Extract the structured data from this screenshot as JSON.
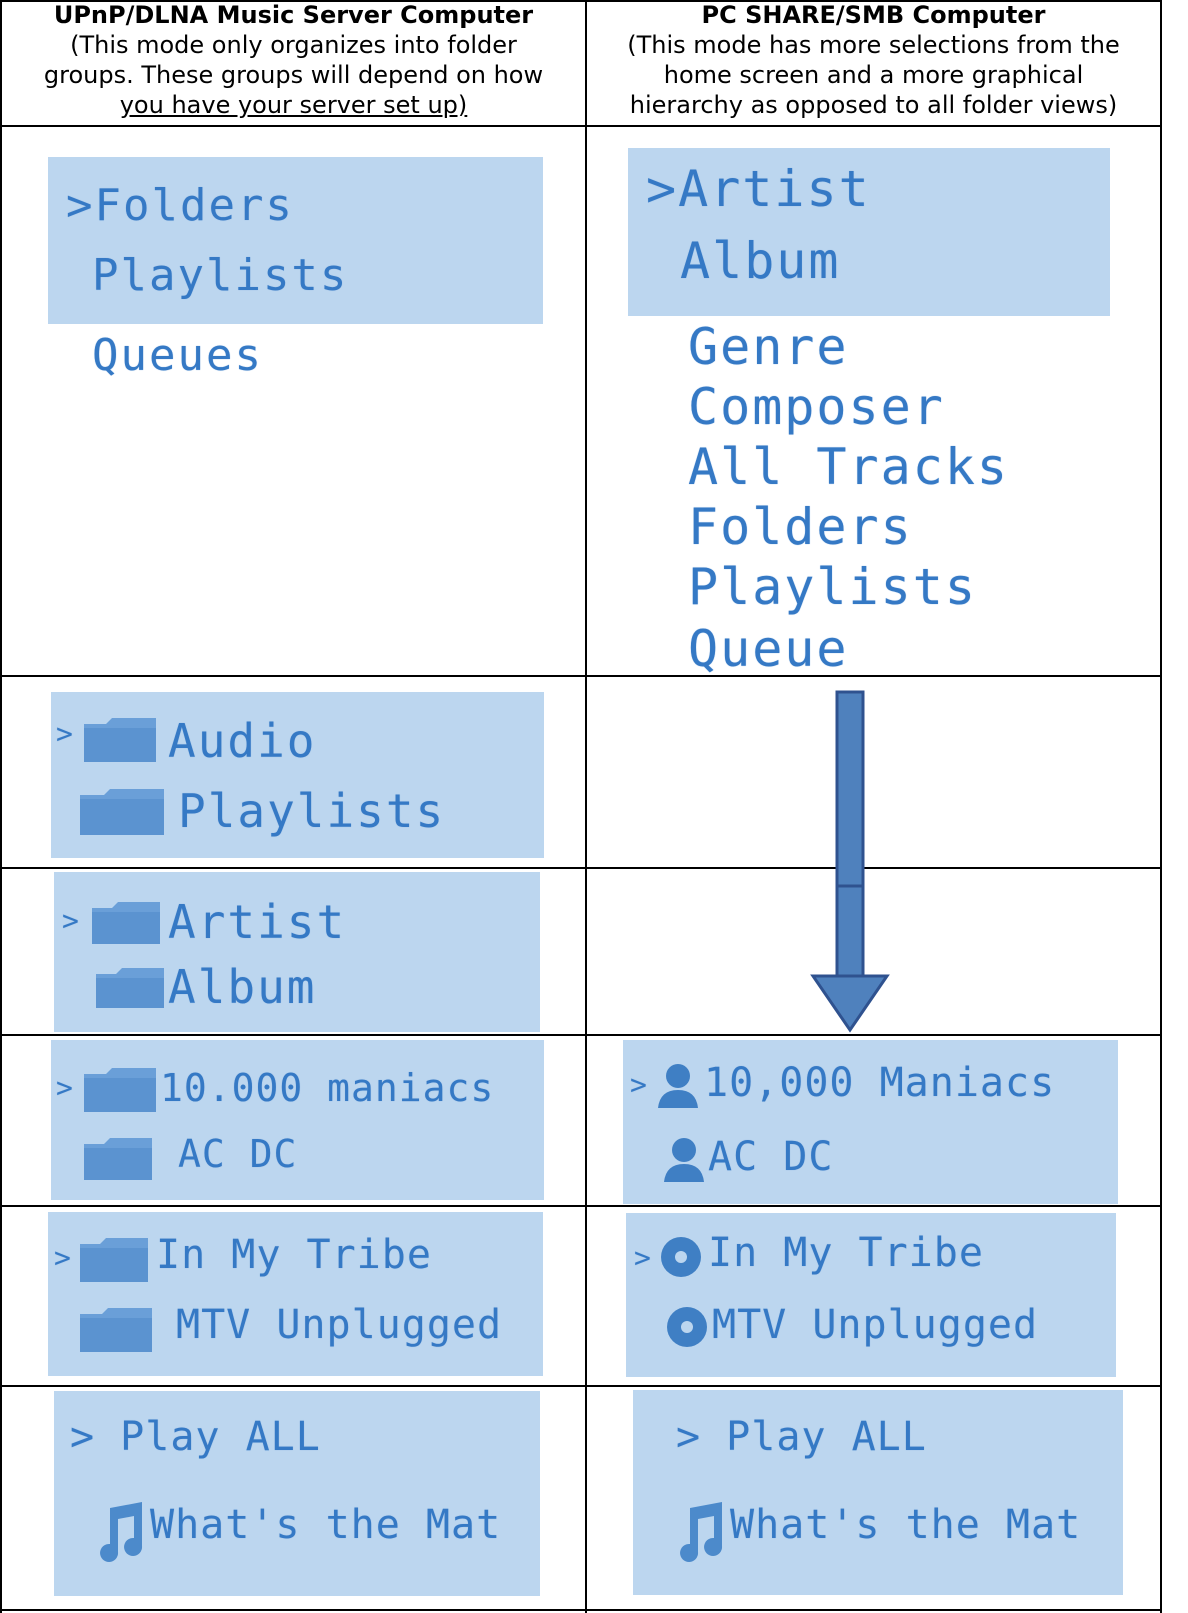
{
  "columns": [
    {
      "title": "UPnP/DLNA Music Server Computer",
      "desc": [
        "(This mode only organizes into folder",
        "groups.  These groups will depend on how",
        "you have your server set up)"
      ]
    },
    {
      "title": "PC SHARE/SMB Computer",
      "desc": [
        "(This mode has more selections from the",
        "home screen and a more graphical",
        "hierarchy as opposed to all folder views)"
      ]
    }
  ],
  "left": {
    "home": {
      "selected": ">Folders",
      "second": "Playlists",
      "below": "Queues"
    },
    "audio": {
      "cursor": ">",
      "item1": "Audio",
      "item2": "Playlists"
    },
    "artist": {
      "cursor": ">",
      "item1": "Artist",
      "item2": "Album"
    },
    "artists_list": {
      "cursor": ">",
      "item1": "10.000 maniacs",
      "item2": "AC DC"
    },
    "albums_list": {
      "cursor": ">",
      "item1": "In My Tribe",
      "item2": "MTV Unplugged"
    },
    "tracks_list": {
      "item1": "> Play ALL",
      "item2": "What's the Mat"
    }
  },
  "right": {
    "home": {
      "selected": ">Artist",
      "second": "Album",
      "below": [
        "Genre",
        "Composer",
        "All Tracks",
        "Folders",
        "Playlists",
        "Queue"
      ]
    },
    "artists_list": {
      "cursor": ">",
      "item1": "10,000 Maniacs",
      "item2": "AC DC"
    },
    "albums_list": {
      "cursor": ">",
      "item1": "In My Tribe",
      "item2": "MTV Unplugged"
    },
    "tracks_list": {
      "item1": "> Play ALL",
      "item2": "What's the Mat"
    }
  },
  "colors": {
    "panel": "#bcd6ef",
    "lcd_text": "#3579c5",
    "arrow_fill": "#4f81bd",
    "arrow_stroke": "#2f528f"
  },
  "icons": [
    "folder-icon",
    "person-icon",
    "disc-icon",
    "music-note-icon",
    "down-arrow-icon"
  ]
}
